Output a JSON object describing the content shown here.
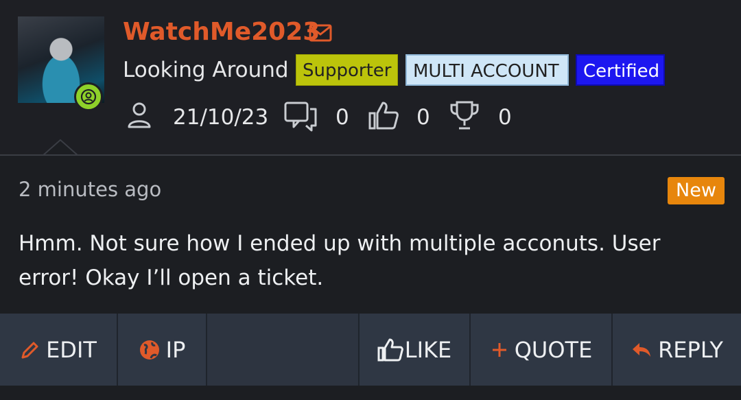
{
  "user": {
    "name": "WatchMe2023",
    "title": "Looking Around",
    "badges": [
      "Supporter",
      "MULTI ACCOUNT",
      "Certified"
    ],
    "stats": {
      "joined": "21/10/23",
      "messages": "0",
      "reactions": "0",
      "points": "0"
    }
  },
  "post": {
    "time": "2 minutes ago",
    "new_label": "New",
    "text": "Hmm. Not sure how I ended up with multiple acconuts. User error! Okay I’ll open a ticket."
  },
  "actions": {
    "edit": "EDIT",
    "ip": "IP",
    "like": "LIKE",
    "quote": "QUOTE",
    "reply": "REPLY"
  },
  "colors": {
    "username": "#e05a2a",
    "supporter": "#bcc40b",
    "multi_account": "#cfe6f7",
    "certified": "#1d17f0",
    "new_badge": "#e7860c",
    "online": "#8fd12a",
    "action_icon": "#e05a2a"
  }
}
